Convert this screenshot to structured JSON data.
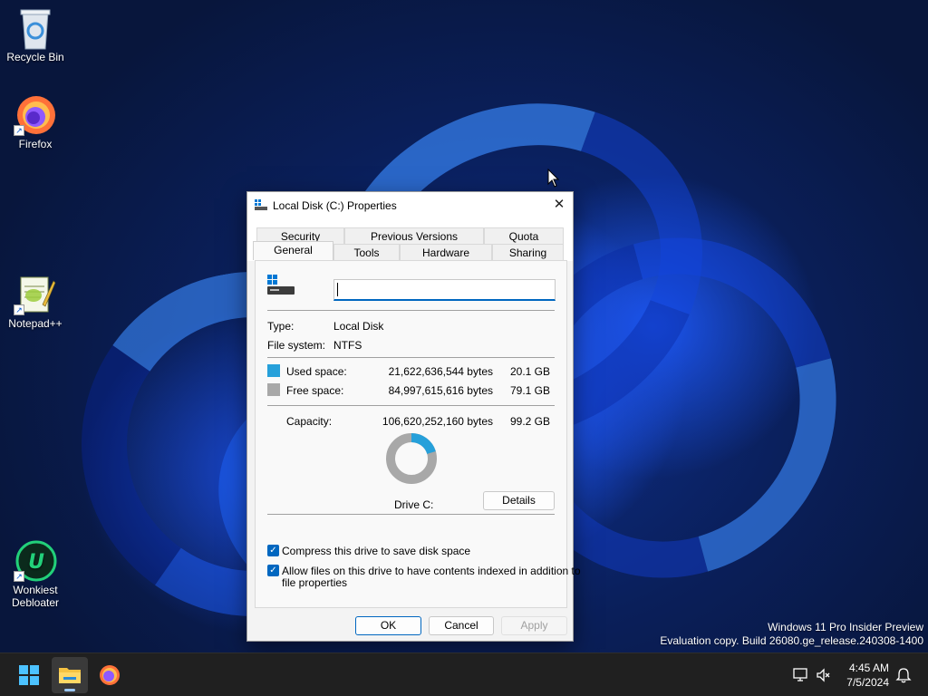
{
  "desktop": {
    "icons": [
      {
        "label": "Recycle Bin",
        "icon": "recycle-bin-icon"
      },
      {
        "label": "Firefox",
        "icon": "firefox-icon"
      },
      {
        "label": "Notepad++",
        "icon": "notepadpp-icon"
      },
      {
        "label": "Wonkiest Debloater",
        "label_line1": "Wonkiest",
        "label_line2": "Debloater",
        "icon": "wonkiest-debloater-icon"
      }
    ],
    "watermark": {
      "line1": "Windows 11 Pro Insider Preview",
      "line2": "Evaluation copy. Build 26080.ge_release.240308-1400"
    }
  },
  "dialog": {
    "title": "Local Disk (C:) Properties",
    "close_glyph": "✕",
    "tabs_row1": [
      "Security",
      "Previous Versions",
      "Quota"
    ],
    "tabs_row2": [
      "General",
      "Tools",
      "Hardware",
      "Sharing"
    ],
    "active_tab": "General",
    "name_value": "",
    "type_label": "Type:",
    "type_value": "Local Disk",
    "fs_label": "File system:",
    "fs_value": "NTFS",
    "used_label": "Used space:",
    "used_bytes": "21,622,636,544 bytes",
    "used_gb": "20.1 GB",
    "free_label": "Free space:",
    "free_bytes": "84,997,615,616 bytes",
    "free_gb": "79.1 GB",
    "capacity_label": "Capacity:",
    "capacity_bytes": "106,620,252,160 bytes",
    "capacity_gb": "99.2 GB",
    "used_fraction": 0.203,
    "drive_label": "Drive C:",
    "details_button": "Details",
    "compress_label": "Compress this drive to save disk space",
    "compress_checked": true,
    "index_label_line1": "Allow files on this drive to have contents indexed in addition to",
    "index_label_line2": "file properties",
    "index_checked": true,
    "ok_button": "OK",
    "cancel_button": "Cancel",
    "apply_button": "Apply",
    "colors": {
      "used": "#26a0da",
      "free": "#a8a8a8",
      "accent": "#0067c0"
    }
  },
  "taskbar": {
    "apps": [
      "start-icon",
      "file-explorer-icon",
      "firefox-icon"
    ],
    "time": "4:45 AM",
    "date": "7/5/2024"
  }
}
